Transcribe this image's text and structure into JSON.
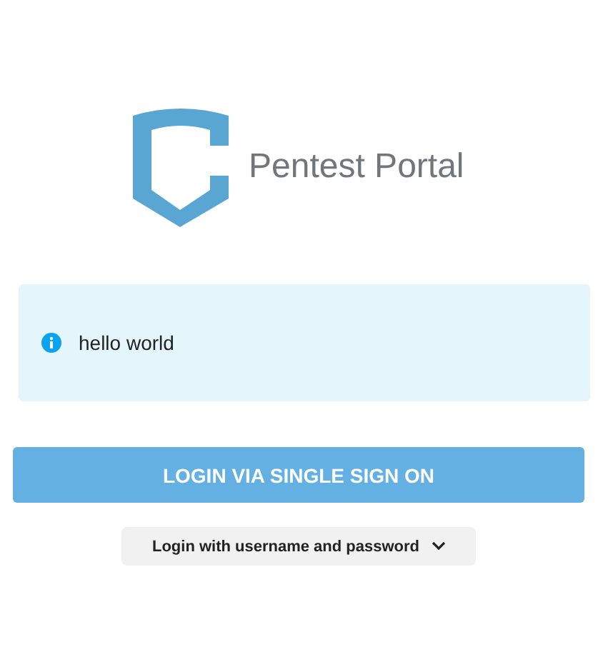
{
  "brand": {
    "title": "Pentest Portal"
  },
  "alert": {
    "message": "hello world"
  },
  "sso_button": {
    "label": "LOGIN VIA SINGLE SIGN ON"
  },
  "credentials_toggle": {
    "label": "Login with username and password",
    "expanded": false
  }
}
